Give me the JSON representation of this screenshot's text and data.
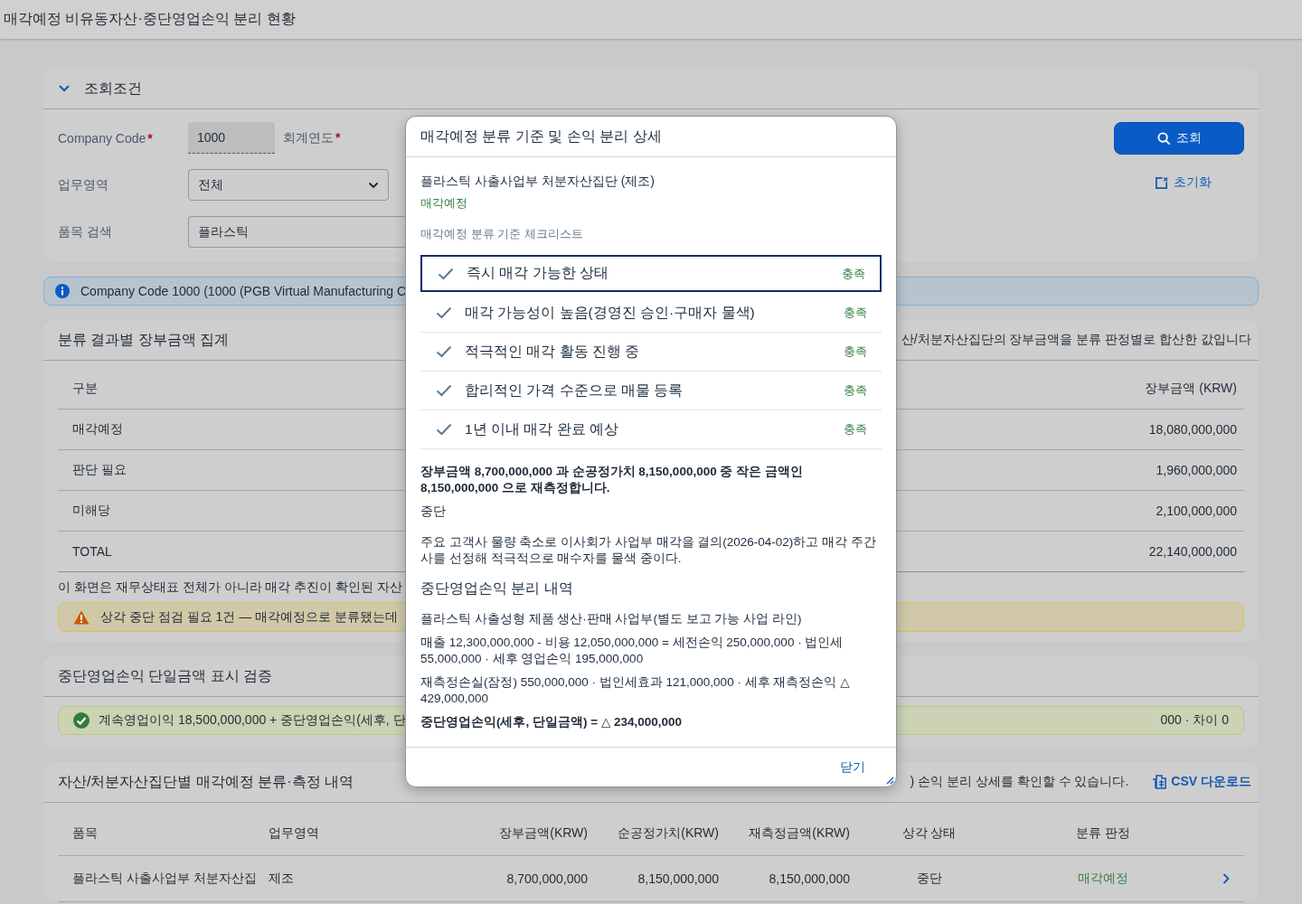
{
  "page_title": "매각예정 비유동자산·중단영업손익 분리 현황",
  "filters": {
    "title": "조회조건",
    "expanded": true,
    "fields": [
      {
        "kind": "readonly",
        "label": "Company Code",
        "required_mark": "*",
        "value": "1000",
        "side_label": "회계연도",
        "side_required_mark": "*"
      },
      {
        "kind": "select",
        "label": "업무영역",
        "value": "전체"
      },
      {
        "kind": "text",
        "label": "품목 검색",
        "value": "플라스틱"
      }
    ],
    "search_button": "조회",
    "reset_link": "초기화"
  },
  "info_message": "Company Code 1000 (1000 (PGB Virtual Manufacturing C",
  "summary": {
    "title": "분류 결과별 장부금액 집계",
    "note_right": "산/처분자산집단의 장부금액을 분류 판정별로 합산한 값입니다",
    "columns": [
      "구분",
      "장부금액 (KRW)"
    ],
    "rows": [
      {
        "label": "매각예정",
        "amount": "18,080,000,000",
        "kind": "normal"
      },
      {
        "label": "판단 필요",
        "amount": "1,960,000,000",
        "kind": "normal"
      },
      {
        "label": "미해당",
        "amount": "2,100,000,000",
        "kind": "normal"
      },
      {
        "label": "TOTAL",
        "amount": "22,140,000,000",
        "kind": "total"
      }
    ],
    "footnote": "이 화면은 재무상태표 전체가 아니라 매각 추진이 확인된 자산",
    "warning": "상각 중단 점검 필요 1건 — 매각예정으로 분류됐는데"
  },
  "check": {
    "title": "중단영업손익 단일금액 표시 검증",
    "message_left": "계속영업이익 18,500,000,000 + 중단영업손익(세후, 단",
    "message_right": "000 · 차이 0"
  },
  "detail": {
    "title": "자산/처분자산집단별 매각예정 분류·측정 내역",
    "hint_right": ") 손익 분리 상세를 확인할 수 있습니다.",
    "csv_link": "CSV 다운로드",
    "columns": [
      "품목",
      "업무영역",
      "장부금액(KRW)",
      "순공정가치(KRW)",
      "재측정금액(KRW)",
      "상각 상태",
      "분류 판정"
    ],
    "rows": [
      {
        "cells": [
          "플라스틱 사출사업부 처분자산집",
          "제조",
          "8,700,000,000",
          "8,150,000,000",
          "8,150,000,000",
          "중단"
        ],
        "judgement": "매각예정"
      }
    ]
  },
  "dialog": {
    "title": "매각예정 분류 기준 및 손익 분리 상세",
    "asset": "플라스틱 사출사업부 처분자산집단 (제조)",
    "status": "매각예정",
    "checklist_title": "매각예정 분류 기준 체크리스트",
    "checklist": [
      {
        "label": "즉시 매각 가능한 상태",
        "result": "충족",
        "checked": true,
        "selected": true
      },
      {
        "label": "매각 가능성이 높음(경영진 승인·구매자 물색)",
        "result": "충족",
        "checked": true,
        "selected": false
      },
      {
        "label": "적극적인 매각 활동 진행 중",
        "result": "충족",
        "checked": true,
        "selected": false
      },
      {
        "label": "합리적인 가격 수준으로 매물 등록",
        "result": "충족",
        "checked": true,
        "selected": false
      },
      {
        "label": "1년 이내 매각 완료 예상",
        "result": "충족",
        "checked": true,
        "selected": false
      }
    ],
    "measurement": "장부금액 8,700,000,000 과 순공정가치 8,150,000,000 중 작은 금액인 8,150,000,000 으로 재측정합니다.",
    "depreciation": "중단",
    "reason": "주요 고객사 물량 축소로 이사회가 사업부 매각을 결의(2026-04-02)하고 매각 주간사를 선정해 적극적으로 매수자를 물색 중이다.",
    "section_title": "중단영업손익 분리 내역",
    "business": "플라스틱 사출성형 제품 생산·판매 사업부(별도 보고 가능 사업 라인)",
    "calc_lines": [
      "매출 12,300,000,000 - 비용 12,050,000,000 = 세전손익 250,000,000 · 법인세 55,000,000 · 세후 영업손익 195,000,000",
      "재측정손실(잠정) 550,000,000 · 법인세효과 121,000,000 · 세후 재측정손익 △ 429,000,000"
    ],
    "result": "중단영업손익(세후, 단일금액) = △ 234,000,000",
    "close_button": "닫기"
  }
}
